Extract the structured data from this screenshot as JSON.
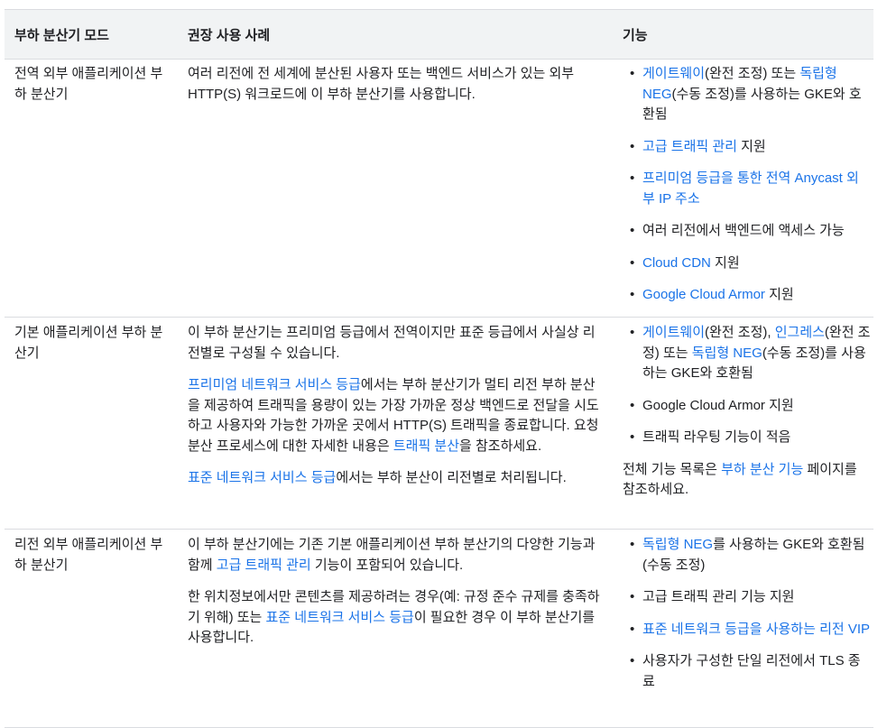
{
  "headers": [
    "부하 분산기 모드",
    "권장 사용 사례",
    "기능"
  ],
  "rows": [
    {
      "mode": "전역 외부 애플리케이션 부하 분산기",
      "usecase_p1": "여러 리전에 전 세계에 분산된 사용자 또는 백엔드 서비스가 있는 외부 HTTP(S) 워크로드에 이 부하 분산기를 사용합니다.",
      "features": {
        "f1_link1": "게이트웨이",
        "f1_text1": "(완전 조정) 또는 ",
        "f1_link2": "독립형 NEG",
        "f1_text2": "(수동 조정)를 사용하는 GKE와 호환됨",
        "f2_link": "고급 트래픽 관리",
        "f2_text": " 지원",
        "f3_link": "프리미엄 등급을 통한 전역 Anycast 외부 IP 주소",
        "f4_text": "여러 리전에서 백엔드에 액세스 가능",
        "f5_link": "Cloud CDN",
        "f5_text": " 지원",
        "f6_link": "Google Cloud Armor",
        "f6_text": " 지원"
      }
    },
    {
      "mode": "기본 애플리케이션 부하 분산기",
      "usecase_p1": "이 부하 분산기는 프리미엄 등급에서 전역이지만 표준 등급에서 사실상 리전별로 구성될 수 있습니다.",
      "usecase_p2_link1": "프리미엄 네트워크 서비스 등급",
      "usecase_p2_text1": "에서는 부하 분산기가 멀티 리전 부하 분산을 제공하여 트래픽을 용량이 있는 가장 가까운 정상 백엔드로 전달을 시도하고 사용자와 가능한 가까운 곳에서 HTTP(S) 트래픽을 종료합니다. 요청 분산 프로세스에 대한 자세한 내용은 ",
      "usecase_p2_link2": "트래픽 분산",
      "usecase_p2_text2": "을 참조하세요.",
      "usecase_p3_link": "표준 네트워크 서비스 등급",
      "usecase_p3_text": "에서는 부하 분산이 리전별로 처리됩니다.",
      "features": {
        "f1_link1": "게이트웨이",
        "f1_text1": "(완전 조정), ",
        "f1_link2": "인그레스",
        "f1_text2": "(완전 조정) 또는 ",
        "f1_link3": "독립형 NEG",
        "f1_text3": "(수동 조정)를 사용하는 GKE와 호환됨",
        "f2_text": "Google Cloud Armor 지원",
        "f3_text": "트래픽 라우팅 기능이 적음",
        "note_text1": "전체 기능 목록은 ",
        "note_link": "부하 분산 기능",
        "note_text2": " 페이지를 참조하세요."
      }
    },
    {
      "mode": "리전 외부 애플리케이션 부하 분산기",
      "usecase_p1_text1": "이 부하 분산기에는 기존 기본 애플리케이션 부하 분산기의 다양한 기능과 함께 ",
      "usecase_p1_link": "고급 트래픽 관리",
      "usecase_p1_text2": " 기능이 포함되어 있습니다.",
      "usecase_p2_text1": "한 위치정보에서만 콘텐츠를 제공하려는 경우(예: 규정 준수 규제를 충족하기 위해) 또는 ",
      "usecase_p2_link": "표준 네트워크 서비스 등급",
      "usecase_p2_text2": "이 필요한 경우 이 부하 분산기를 사용합니다.",
      "features": {
        "f1_link": "독립형 NEG",
        "f1_text": "를 사용하는 GKE와 호환됨(수동 조정)",
        "f2_text": "고급 트래픽 관리 기능 지원",
        "f3_link": "표준 네트워크 등급을 사용하는 리전 VIP",
        "f4_text": "사용자가 구성한 단일 리전에서 TLS 종료"
      }
    }
  ]
}
